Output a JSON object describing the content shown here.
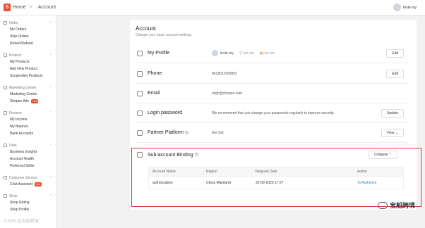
{
  "topbar": {
    "logo": "S",
    "home": "Home",
    "separator": ">",
    "current": "Account",
    "user": "teste.my"
  },
  "sidebar": [
    {
      "title": "Order",
      "items": [
        "My Orders",
        "Ship Orders",
        "Return/Refund"
      ]
    },
    {
      "title": "Product",
      "items": [
        "My Products",
        "Add New Product",
        "Suspended Products"
      ]
    },
    {
      "title": "Marketing Centre",
      "items": [
        "Marketing Centre",
        "Shopee Ads"
      ],
      "hot": "Hot"
    },
    {
      "title": "Finance",
      "items": [
        "My Income",
        "My Balance",
        "Bank Accounts"
      ]
    },
    {
      "title": "Data",
      "items": [
        "Business Insights",
        "Account Health",
        "Preferred Seller"
      ]
    },
    {
      "title": "Customer Service",
      "items": [
        "Chat Assistant"
      ],
      "hot": "Hot"
    },
    {
      "title": "Shop",
      "items": [
        "Shop Rating",
        "Shop Profile"
      ]
    }
  ],
  "account": {
    "title": "Account",
    "subtitle": "Change your basic account settings.",
    "profile": {
      "label": "My Profile",
      "username": "teste.my",
      "tag1": "not set",
      "tag2": "not set",
      "button": "Edit"
    },
    "phone": {
      "label": "Phone",
      "value": "8618011900882",
      "button": "Edit"
    },
    "email": {
      "label": "Email",
      "value": "sdgh@shopee.com"
    },
    "password": {
      "label": "Login password",
      "value": "We recommend that you change your passwords regularly to improve security.",
      "button": "Update"
    },
    "partner": {
      "label": "Partner Platform",
      "value": "Not Set",
      "button": "View"
    },
    "subaccount": {
      "label": "Sub-account Binding",
      "button": "Collapse",
      "columns": [
        "Account Name",
        "Region",
        "Request Date",
        "Action"
      ],
      "rows": [
        {
          "account": "authorization",
          "region": "China Mainland",
          "date": "22-09-2020 17:27",
          "action": "To Authorize"
        }
      ]
    }
  },
  "watermark": "宝船跨境",
  "watermark_left": "CSDN @宝船跨境",
  "colors": {
    "brand": "#ee4d2d",
    "highlight": "#e0392e",
    "link": "#3e76c7"
  }
}
